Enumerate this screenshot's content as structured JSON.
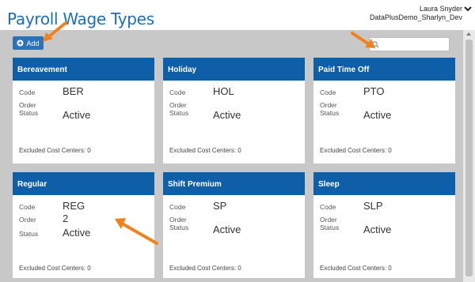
{
  "header": {
    "title": "Payroll Wage Types",
    "user_name": "Laura Snyder",
    "user_db": "DataPlusDemo_Sharlyn_Dev"
  },
  "toolbar": {
    "add_label": "Add",
    "search_value": "",
    "search_placeholder": ""
  },
  "labels": {
    "code": "Code",
    "order": "Order",
    "status": "Status"
  },
  "cards": [
    {
      "name": "Bereavement",
      "code": "BER",
      "order": "",
      "status": "Active",
      "excluded": "Excluded Cost Centers: 0"
    },
    {
      "name": "Holiday",
      "code": "HOL",
      "order": "",
      "status": "Active",
      "excluded": "Excluded Cost Centers: 0"
    },
    {
      "name": "Paid Time Off",
      "code": "PTO",
      "order": "",
      "status": "Active",
      "excluded": "Excluded Cost Centers: 0"
    },
    {
      "name": "Regular",
      "code": "REG",
      "order": "2",
      "status": "Active",
      "excluded": "Excluded Cost Centers: 0"
    },
    {
      "name": "Shift Premium",
      "code": "SP",
      "order": "",
      "status": "Active",
      "excluded": "Excluded Cost Centers: 0"
    },
    {
      "name": "Sleep",
      "code": "SLP",
      "order": "",
      "status": "Active",
      "excluded": "Excluded Cost Centers: 0"
    }
  ],
  "colors": {
    "accent": "#1c6eb7",
    "card_header": "#0f5fa8",
    "annotation_arrow": "#f0821e"
  },
  "icons": [
    "plus-circle-icon",
    "search-icon",
    "chevron-down-icon",
    "annotation-arrow"
  ]
}
